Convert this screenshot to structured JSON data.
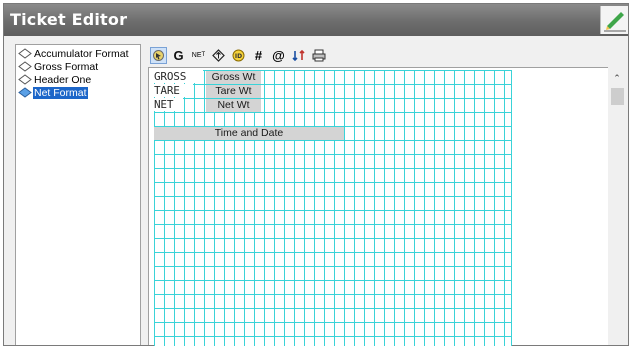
{
  "window": {
    "title": "Ticket Editor"
  },
  "tree": {
    "items": [
      {
        "label": "Accumulator Format",
        "selected": false
      },
      {
        "label": "Gross Format",
        "selected": false
      },
      {
        "label": "Header One",
        "selected": false
      },
      {
        "label": "Net Format",
        "selected": true
      }
    ]
  },
  "toolbar": {
    "buttons": [
      {
        "name": "select-tool-icon",
        "glyph": ""
      },
      {
        "name": "gross-icon",
        "glyph": "G"
      },
      {
        "name": "net-icon",
        "glyph": "ᴺᴇᴛ"
      },
      {
        "name": "tare-icon",
        "glyph": "⊕"
      },
      {
        "name": "id-icon",
        "glyph": "ID"
      },
      {
        "name": "number-icon",
        "glyph": "#"
      },
      {
        "name": "at-icon",
        "glyph": "@"
      },
      {
        "name": "transfer-icon",
        "glyph": "t↓"
      },
      {
        "name": "print-icon",
        "glyph": ""
      }
    ]
  },
  "layout": {
    "labels": [
      "GROSS",
      "TARE",
      "NET"
    ],
    "fields": [
      "Gross Wt",
      "Tare Wt",
      "Net Wt",
      "Time and Date"
    ]
  },
  "colors": {
    "grid": "#3ad3d8",
    "selection": "#1c66c9",
    "field": "#d4d4d4"
  }
}
